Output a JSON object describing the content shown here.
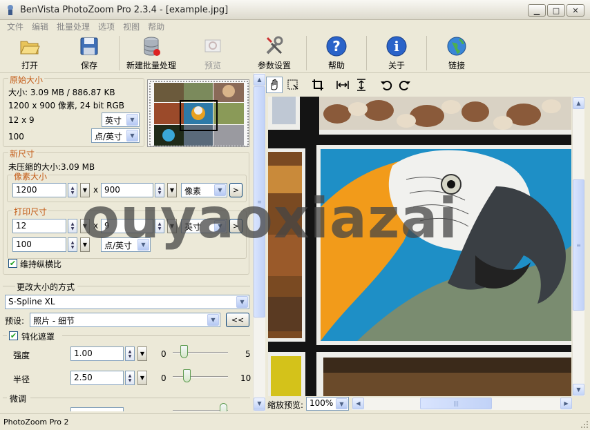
{
  "window": {
    "title": "BenVista PhotoZoom Pro 2.3.4 - [example.jpg]",
    "minimize": "▁",
    "maximize": "□",
    "close": "✕"
  },
  "menu": [
    "文件",
    "编辑",
    "批量处理",
    "选项",
    "视图",
    "帮助"
  ],
  "toolbar": {
    "open": "打开",
    "save": "保存",
    "batch": "新建批量处理",
    "preview": "预览",
    "settings": "参数设置",
    "help": "帮助",
    "about": "关于",
    "link": "链接"
  },
  "original": {
    "title": "原始大小",
    "size": "大小: 3.09 MB / 886.87 KB",
    "pixels": "1200 x 900 像素, 24 bit RGB",
    "dims": "12 x 9",
    "dims_unit": "英寸",
    "res": "100",
    "res_unit": "点/英寸"
  },
  "newsize": {
    "title": "新尺寸",
    "uncompressed": "未压缩的大小:3.09 MB",
    "pixel": {
      "title": "像素大小",
      "width": "1200",
      "x": "x",
      "height": "900",
      "unit": "像素",
      "more": ">"
    },
    "print": {
      "title": "打印尺寸",
      "width": "12",
      "x": "x",
      "height": "9",
      "unit": "英寸",
      "more": ">",
      "res": "100",
      "res_unit": "点/英寸"
    },
    "keep_ratio": "维持纵横比"
  },
  "resize": {
    "title": "更改大小的方式",
    "method": "S-Spline XL",
    "preset_label": "预设:",
    "preset": "照片 - 细节",
    "preset_btn": "<<",
    "unsharp": "钝化遮罩",
    "strength_label": "强度",
    "strength": "1.00",
    "strength_min": "0",
    "strength_max": "5",
    "radius_label": "半径",
    "radius": "2.50",
    "radius_min": "0",
    "radius_max": "10",
    "fine": "微调"
  },
  "view": {
    "zoom_label": "缩放预览:",
    "zoom": "100%"
  },
  "status": {
    "text": "PhotoZoom Pro 2"
  },
  "watermark": "ouyaoxiazai",
  "icons": {
    "hand": "hand-icon",
    "marquee": "marquee-icon",
    "crop": "crop-icon",
    "fit-width": "fit-width-icon",
    "fit-height": "fit-height-icon",
    "rotate-left": "rotate-left-icon",
    "rotate-right": "rotate-right-icon"
  }
}
